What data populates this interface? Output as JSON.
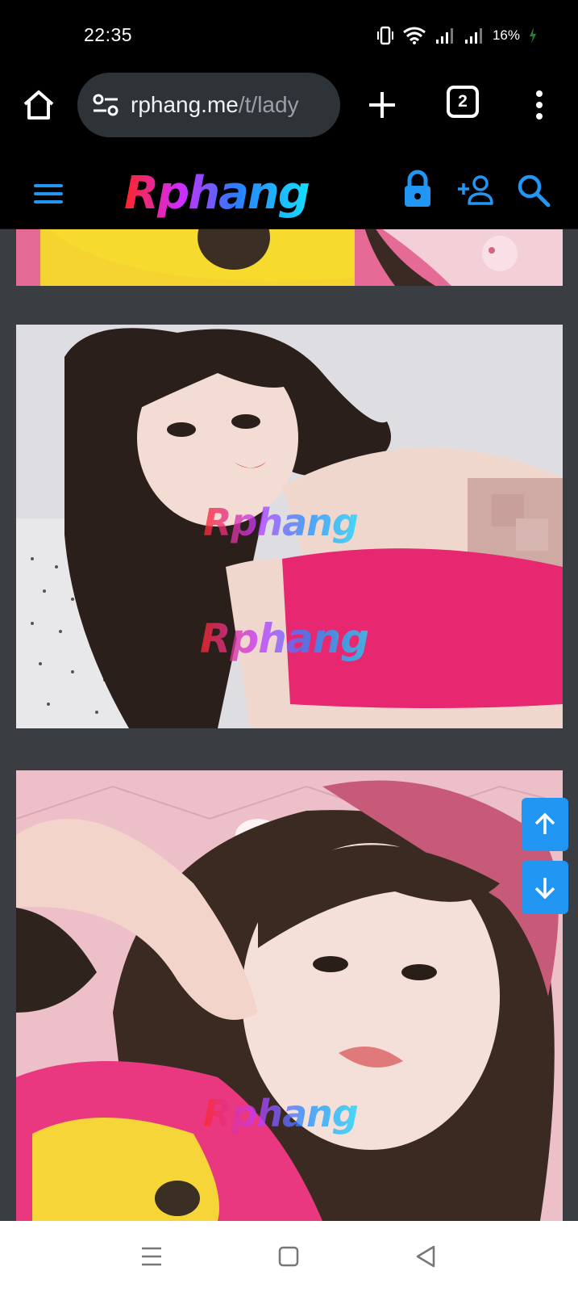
{
  "status_bar": {
    "time": "22:35",
    "battery": "16%",
    "icons": [
      "vibrate-icon",
      "wifi-icon",
      "signal-icon",
      "signal-icon",
      "battery-charging-icon"
    ]
  },
  "browser": {
    "url_host": "rphang.me",
    "url_path": "/t/lady",
    "tab_count": "2",
    "icons": [
      "home-icon",
      "site-info-icon",
      "new-tab-icon",
      "tabs-icon",
      "more-vert-icon"
    ]
  },
  "site_header": {
    "logo_text": "Rphang",
    "icons": [
      "hamburger-icon",
      "lock-icon",
      "add-user-icon",
      "search-icon"
    ],
    "accent_color": "#2196f3"
  },
  "gallery": {
    "watermark": "Rphang",
    "background_color": "#3a3d41"
  },
  "scroll_controls": {
    "up_icon": "arrow-up-icon",
    "down_icon": "arrow-down-icon",
    "color": "#2196f3"
  },
  "system_nav": {
    "icons": [
      "recents-icon",
      "home-icon",
      "back-icon"
    ]
  }
}
